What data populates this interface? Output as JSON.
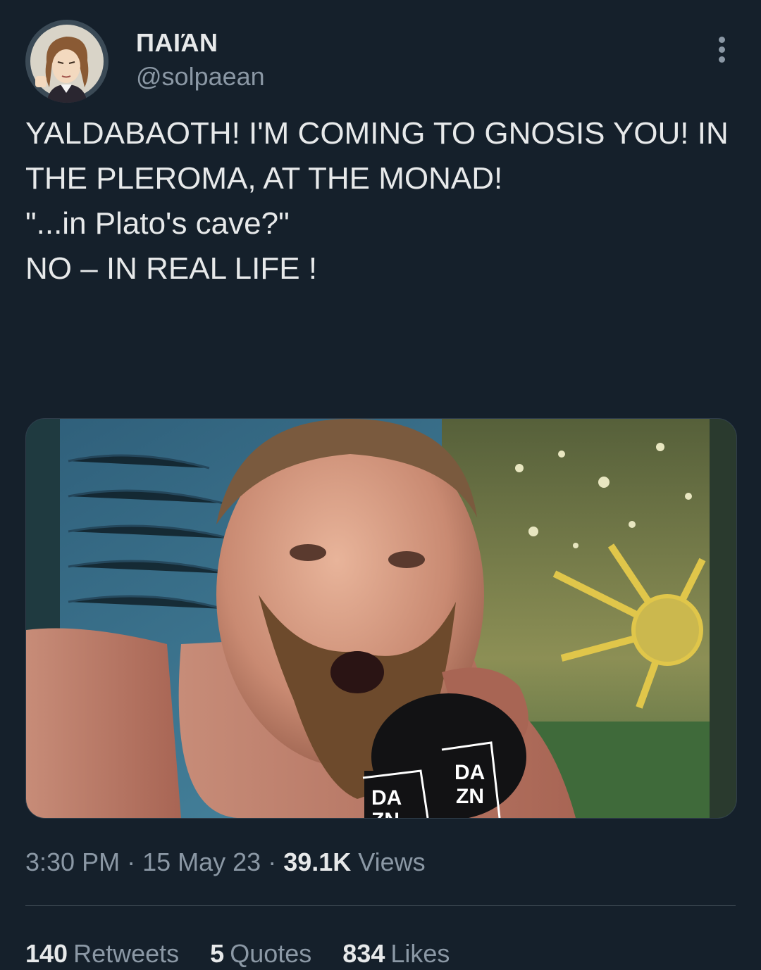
{
  "author": {
    "display_name": "ΠΑΙΆΝ",
    "handle": "@solpaean",
    "avatar_icon": "avatar-illustration-icon"
  },
  "tweet": {
    "lines": [
      "YALDABAOTH! I'M COMING TO GNOSIS YOU! IN THE PLEROMA, AT THE MONAD!",
      "",
      "\"...in Plato's cave?\"",
      "",
      "NO – IN REAL LIFE !"
    ],
    "media": {
      "icon": "photo-icon",
      "mic_text_left": "DA",
      "mic_text_left_2": "ZN",
      "mic_text_right": "DA",
      "mic_text_right_2": "ZN"
    }
  },
  "meta": {
    "time": "3:30 PM",
    "sep1": " · ",
    "date": "15 May 23",
    "sep2": " · ",
    "views_count": "39.1K",
    "views_label": " Views"
  },
  "stats": {
    "retweets_count": "140",
    "retweets_label": "Retweets",
    "quotes_count": "5",
    "quotes_label": "Quotes",
    "likes_count": "834",
    "likes_label": "Likes"
  },
  "colors": {
    "background": "#15202b",
    "text_primary": "#e7e9ea",
    "text_secondary": "#8b98a5",
    "divider": "#38444d"
  }
}
